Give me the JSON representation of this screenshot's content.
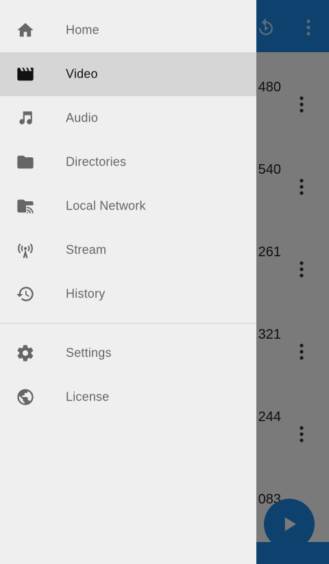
{
  "drawer": {
    "primary_items": [
      {
        "label": "Home",
        "icon": "home-icon",
        "active": false
      },
      {
        "label": "Video",
        "icon": "video-icon",
        "active": true
      },
      {
        "label": "Audio",
        "icon": "music-note-icon",
        "active": false
      },
      {
        "label": "Directories",
        "icon": "folder-icon",
        "active": false
      },
      {
        "label": "Local Network",
        "icon": "network-folder-icon",
        "active": false
      },
      {
        "label": "Stream",
        "icon": "stream-antenna-icon",
        "active": false
      },
      {
        "label": "History",
        "icon": "history-icon",
        "active": false
      }
    ],
    "secondary_items": [
      {
        "label": "Settings",
        "icon": "gear-icon"
      },
      {
        "label": "License",
        "icon": "globe-icon"
      }
    ]
  },
  "background": {
    "list_values": [
      "480",
      "540",
      "261",
      "321",
      "244",
      "083"
    ]
  },
  "colors": {
    "accent": "#1e88e5",
    "drawer_bg": "#efefef",
    "active_bg": "#d6d6d6",
    "icon": "#666666",
    "active_icon": "#111111"
  }
}
